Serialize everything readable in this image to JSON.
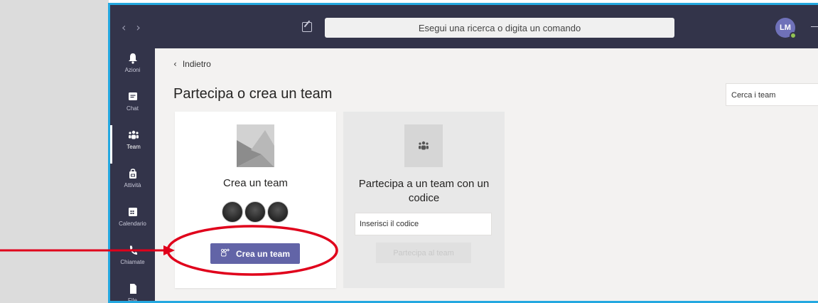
{
  "colors": {
    "frame_border": "#24a8e0",
    "header_bg": "#33344a",
    "brand": "#6264a7",
    "annotation": "#e0001b"
  },
  "header": {
    "back_icon": "chevron-left-icon",
    "forward_icon": "chevron-right-icon",
    "compose_icon": "compose-icon",
    "search_placeholder": "Esegui una ricerca o digita un comando",
    "avatar_initials": "LM"
  },
  "rail": {
    "items": [
      {
        "label": "Azioni",
        "icon": "bell-icon"
      },
      {
        "label": "Chat",
        "icon": "chat-icon"
      },
      {
        "label": "Team",
        "icon": "teams-icon",
        "active": true
      },
      {
        "label": "Attività",
        "icon": "bag-icon"
      },
      {
        "label": "Calendario",
        "icon": "calendar-icon"
      },
      {
        "label": "Chiamate",
        "icon": "phone-icon"
      },
      {
        "label": "File",
        "icon": "file-icon"
      }
    ]
  },
  "main": {
    "back_label": "Indietro",
    "title": "Partecipa o crea un team",
    "team_search_placeholder": "Cerca i team",
    "create_card": {
      "title": "Crea un team",
      "button_label": "Crea un team"
    },
    "join_card": {
      "title": "Partecipa a un team con un codice",
      "code_placeholder": "Inserisci il codice",
      "button_label": "Partecipa al team"
    }
  }
}
